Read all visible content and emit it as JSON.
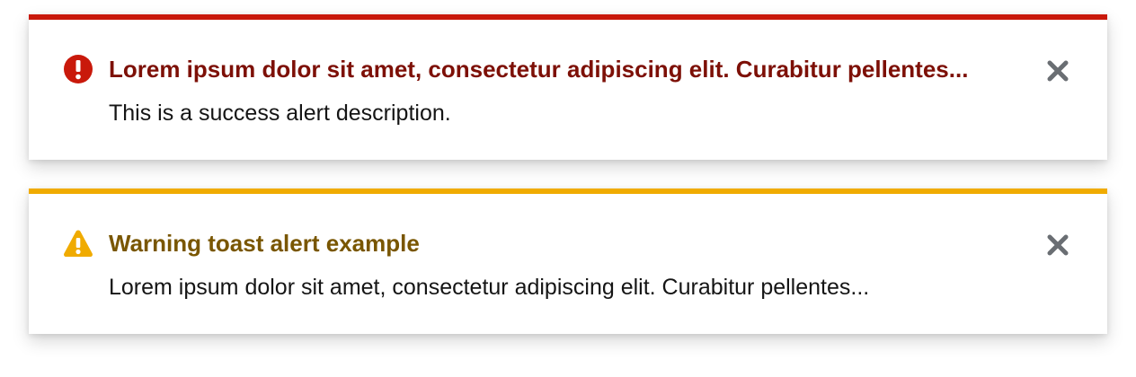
{
  "alerts": [
    {
      "variant": "danger",
      "icon": "exclamation-circle-icon",
      "title": "Lorem ipsum dolor sit amet, consectetur adipiscing elit. Curabitur pellentes...",
      "description": "This is a success alert description.",
      "close_icon": "close-icon",
      "color": "#c9190b",
      "title_color": "#7d1007"
    },
    {
      "variant": "warning",
      "icon": "exclamation-triangle-icon",
      "title": "Warning toast alert example",
      "description": "Lorem ipsum dolor sit amet, consectetur adipiscing elit. Curabitur pellentes...",
      "close_icon": "close-icon",
      "color": "#f0ab00",
      "title_color": "#795600"
    }
  ]
}
